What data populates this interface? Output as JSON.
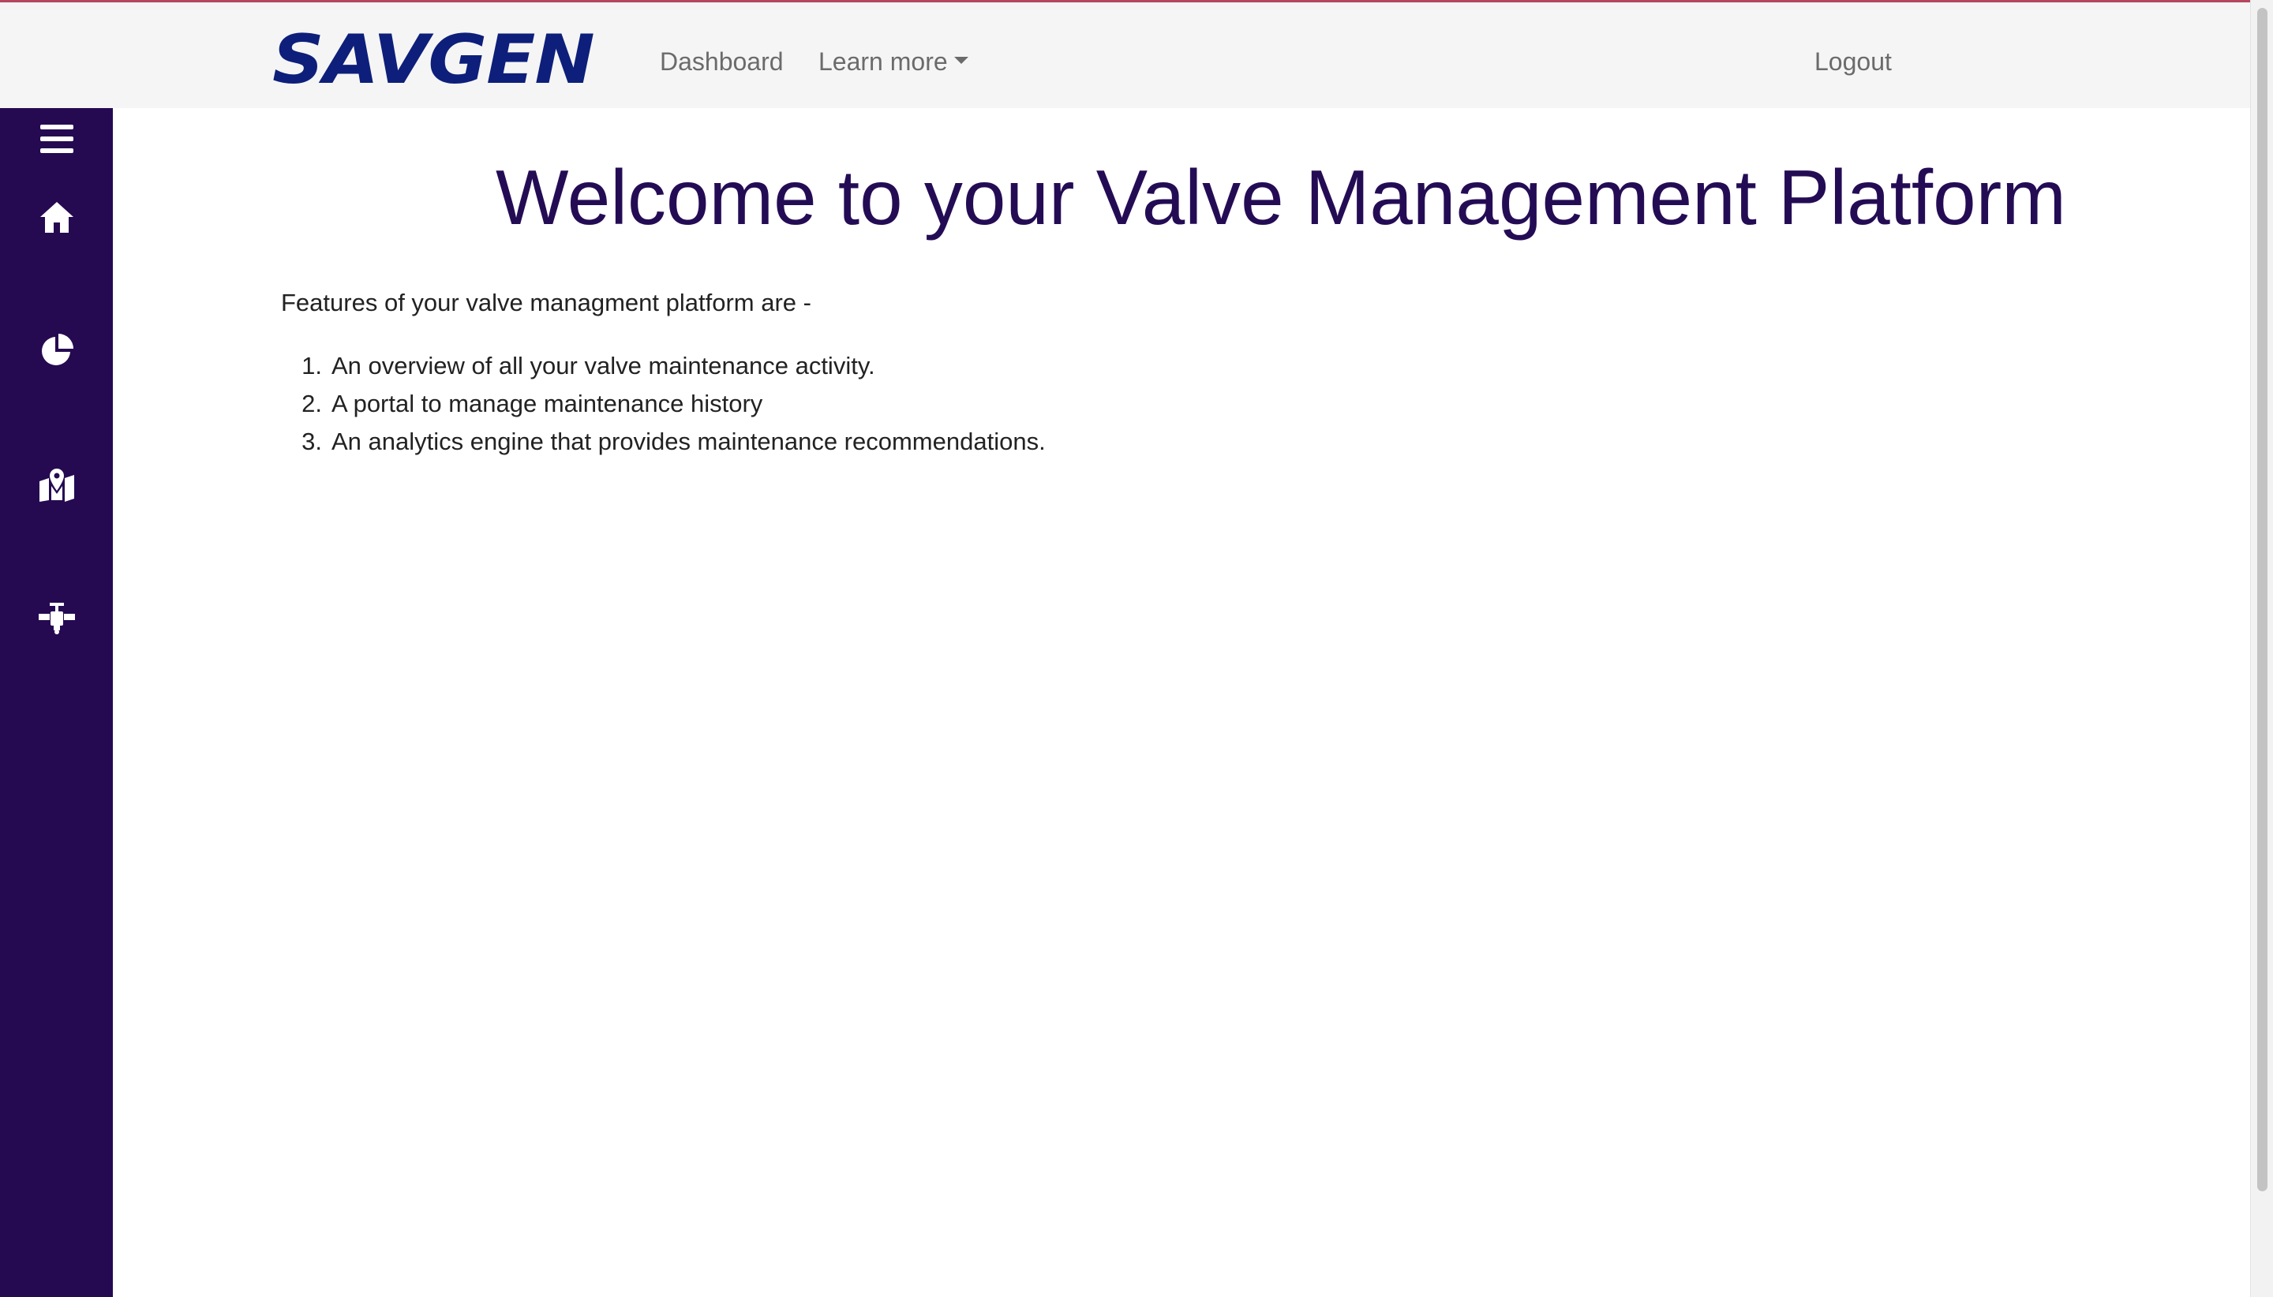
{
  "navbar": {
    "logo_text": "SAVGEN",
    "links": {
      "dashboard": "Dashboard",
      "learn_more": "Learn more",
      "logout": "Logout"
    }
  },
  "sidebar": {
    "items": [
      {
        "name": "menu",
        "icon": "hamburger-icon"
      },
      {
        "name": "home",
        "icon": "home-icon"
      },
      {
        "name": "charts",
        "icon": "pie-chart-icon"
      },
      {
        "name": "map",
        "icon": "map-marker-icon"
      },
      {
        "name": "valves",
        "icon": "valve-icon"
      }
    ]
  },
  "main": {
    "title": "Welcome to your Valve Management Platform",
    "intro": "Features of your valve managment platform are -",
    "features": [
      {
        "num": "1.",
        "text": "An overview of all your valve maintenance activity."
      },
      {
        "num": "2.",
        "text": "A portal to manage maintenance history"
      },
      {
        "num": "3.",
        "text": "An analytics engine that provides maintenance recommendations."
      }
    ]
  },
  "colors": {
    "sidebar_bg": "#250a52",
    "title": "#240c55",
    "logo": "#0d1f7a",
    "navbar_bg": "#f5f5f5"
  }
}
